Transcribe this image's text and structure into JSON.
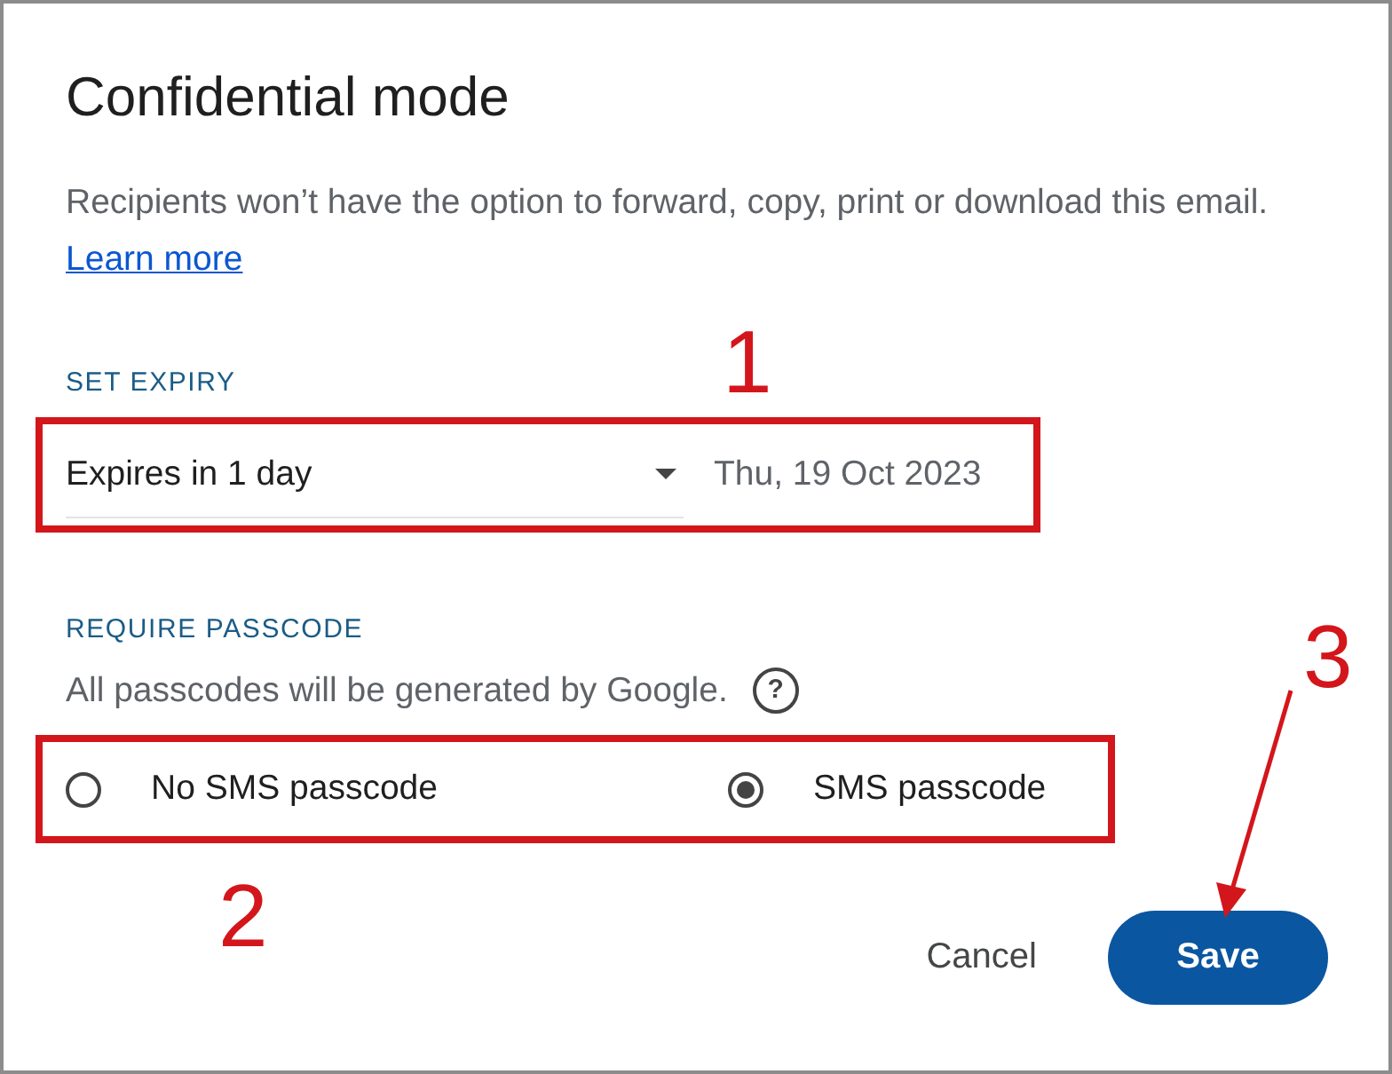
{
  "title": "Confidential mode",
  "description": {
    "text": "Recipients won’t have the option to forward, copy, print or download this email.",
    "link": "Learn more"
  },
  "expiry": {
    "heading": "SET EXPIRY",
    "value": "Expires in 1 day",
    "date": "Thu, 19 Oct 2023"
  },
  "passcode": {
    "heading": "REQUIRE PASSCODE",
    "note": "All passcodes will be generated by Google.",
    "help": "?",
    "options": [
      {
        "label": "No SMS passcode",
        "selected": false
      },
      {
        "label": "SMS passcode",
        "selected": true
      }
    ]
  },
  "buttons": {
    "cancel": "Cancel",
    "save": "Save"
  },
  "annotations": [
    "1",
    "2",
    "3"
  ]
}
